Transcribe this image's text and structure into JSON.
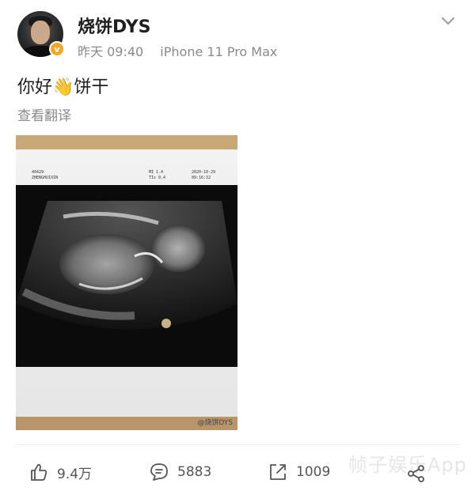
{
  "post": {
    "author": "烧饼DYS",
    "verified_badge": "v",
    "time": "昨天 09:40",
    "device": "iPhone 11 Pro Max",
    "text_before": "你好",
    "emoji": "👋",
    "text_after": "饼干",
    "translate_label": "查看翻译",
    "image": {
      "watermark": "@烧饼DYS",
      "scan_header_left": [
        "40429",
        "ZHENGHUIXIN"
      ],
      "scan_header_right": [
        "MI 1.4",
        "TIs 0.4",
        "2020-10-29",
        "09:16:32"
      ]
    }
  },
  "actions": {
    "like_count": "9.4万",
    "comment_count": "5883",
    "repost_count": "1009"
  },
  "overlay_watermark": {
    "text": "帧子娱乐App"
  },
  "colors": {
    "badge": "#f5a623",
    "secondary_text": "#8a8a8a"
  }
}
